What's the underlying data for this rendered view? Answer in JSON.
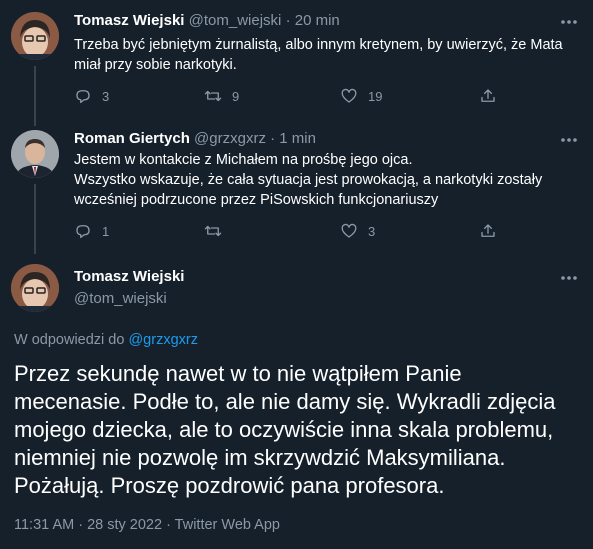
{
  "tweets": [
    {
      "name": "Tomasz Wiejski",
      "handle": "@tom_wiejski",
      "separator": "·",
      "time": "20 min",
      "lines": [
        "Trzeba być jebniętym żurnalistą, albo innym kretynem, by uwierzyć, że Mata",
        "miał przy sobie narkotyki."
      ],
      "replies": "3",
      "retweets": "9",
      "likes": "19"
    },
    {
      "name": "Roman Giertych",
      "handle": "@grzxgxrz",
      "separator": "·",
      "time": "1 min",
      "lines": [
        "Jestem w kontakcie z Michałem na prośbę jego ojca.",
        "Wszystko wskazuje, że cała sytuacja jest prowokacją, a narkotyki zostały",
        "wcześniej podrzucone przez PiSowskich funkcjonariuszy"
      ],
      "replies": "1",
      "retweets": "",
      "likes": "3"
    }
  ],
  "main": {
    "name": "Tomasz Wiejski",
    "handle": "@tom_wiejski",
    "reply_prefix": "W odpowiedzi do ",
    "reply_to": "@grzxgxrz",
    "lines": [
      "Przez sekundę nawet w to nie wątpiłem Panie",
      "mecenasie. Podłe to, ale nie damy się. Wykradli zdjęcia",
      "mojego dziecka, ale to oczywiście inna skala problemu,",
      "niemniej nie pozwolę im skrzywdzić Maksymiliana.",
      "Pożałują. Proszę pozdrowić pana profesora."
    ],
    "meta": "11:31 AM · 28 sty 2022 · Twitter Web App"
  },
  "icons": {
    "reply": "reply-icon",
    "retweet": "retweet-icon",
    "like": "heart-icon",
    "share": "share-icon",
    "more": "more-icon"
  },
  "colors": {
    "background": "#15202b",
    "text": "#ffffff",
    "secondary": "#8b98a5",
    "link": "#1d9bf0",
    "thread_line": "#38444d"
  }
}
